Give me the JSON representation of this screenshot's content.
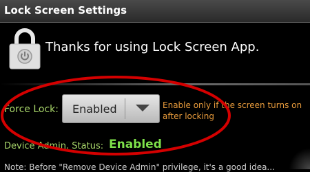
{
  "titlebar": {
    "title": "Lock Screen Settings"
  },
  "app": {
    "icon": "padlock-power-icon",
    "thanks": "Thanks for using Lock Screen App."
  },
  "force_lock": {
    "label": "Force Lock:",
    "value": "Enabled",
    "hint": "Enable only if the screen turns on after locking"
  },
  "device_admin": {
    "label": "Device Admin. Status:",
    "value": "Enabled"
  },
  "bottom": {
    "text": "Note: Before \"Remove Device Admin\" privilege, it's a good idea..."
  },
  "colors": {
    "label_green": "#a8d66a",
    "status_green": "#7ee04a",
    "hint_orange": "#e89b3c",
    "annotation_red": "#d40000"
  }
}
